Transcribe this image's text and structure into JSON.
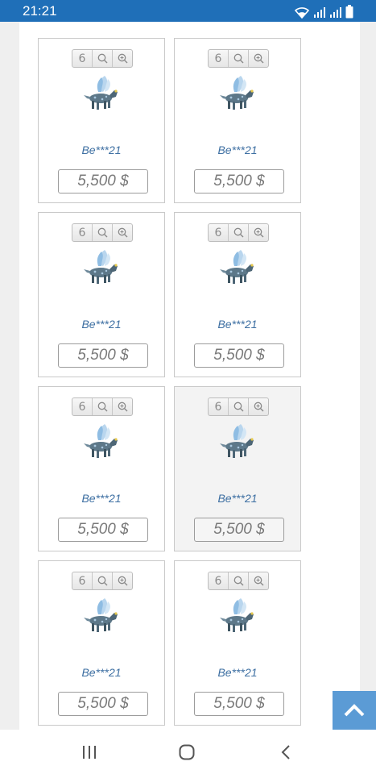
{
  "status_bar": {
    "time": "21:21"
  },
  "listing": {
    "cards": [
      {
        "count": "6",
        "owner": "Be***21",
        "price": "5,500 $"
      },
      {
        "count": "6",
        "owner": "Be***21",
        "price": "5,500 $"
      },
      {
        "count": "6",
        "owner": "Be***21",
        "price": "5,500 $"
      },
      {
        "count": "6",
        "owner": "Be***21",
        "price": "5,500 $"
      },
      {
        "count": "6",
        "owner": "Be***21",
        "price": "5,500 $"
      },
      {
        "count": "6",
        "owner": "Be***21",
        "price": "5,500 $"
      },
      {
        "count": "6",
        "owner": "Be***21",
        "price": "5,500 $"
      },
      {
        "count": "6",
        "owner": "Be***21",
        "price": "5,500 $"
      }
    ]
  },
  "colors": {
    "status_bar": "#1f6fb8",
    "owner_link": "#3d6fa2",
    "scroll_top": "#5b9bd5"
  },
  "icons": [
    "wifi-icon",
    "signal-icon",
    "battery-icon",
    "search-icon",
    "zoom-in-icon",
    "chevron-up-icon",
    "recent-apps-icon",
    "home-icon",
    "back-icon"
  ]
}
